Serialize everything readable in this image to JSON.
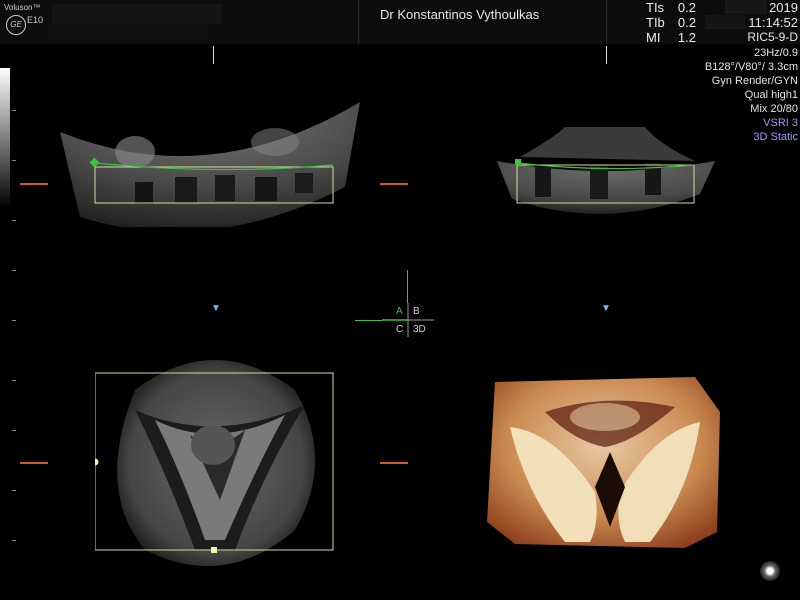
{
  "header": {
    "brand": "Voluson™",
    "logo": "GE",
    "model": "E10",
    "operator": "Dr Konstantinos Vythoulkas",
    "indices": [
      {
        "label": "TIs",
        "value": "0.2"
      },
      {
        "label": "TIb",
        "value": "0.2"
      },
      {
        "label": "MI",
        "value": "1.2"
      }
    ],
    "date_fragment": "2019",
    "time_fragment": "11:14:52"
  },
  "settings": {
    "lines": [
      "RIC5-9-D",
      "23Hz/0.9",
      "B128°/V80°/ 3.3cm",
      "Gyn Render/GYN",
      "Qual high1",
      "Mix 20/80"
    ],
    "mode_lines": [
      "VSRI 3",
      "3D Static"
    ],
    "mode_color": "#9a9aff"
  },
  "quadrants": {
    "labels": [
      "A",
      "B",
      "C",
      "3D"
    ],
    "active_color": "#3cc43c",
    "ref_line_color": "#3cc43c",
    "roi_box_color": "#d8d8a0",
    "orange_marker_color": "#d25a1e",
    "blue_marker_color": "#7fb0ff"
  },
  "icons": {
    "cursor": "trackball-cursor-icon"
  }
}
